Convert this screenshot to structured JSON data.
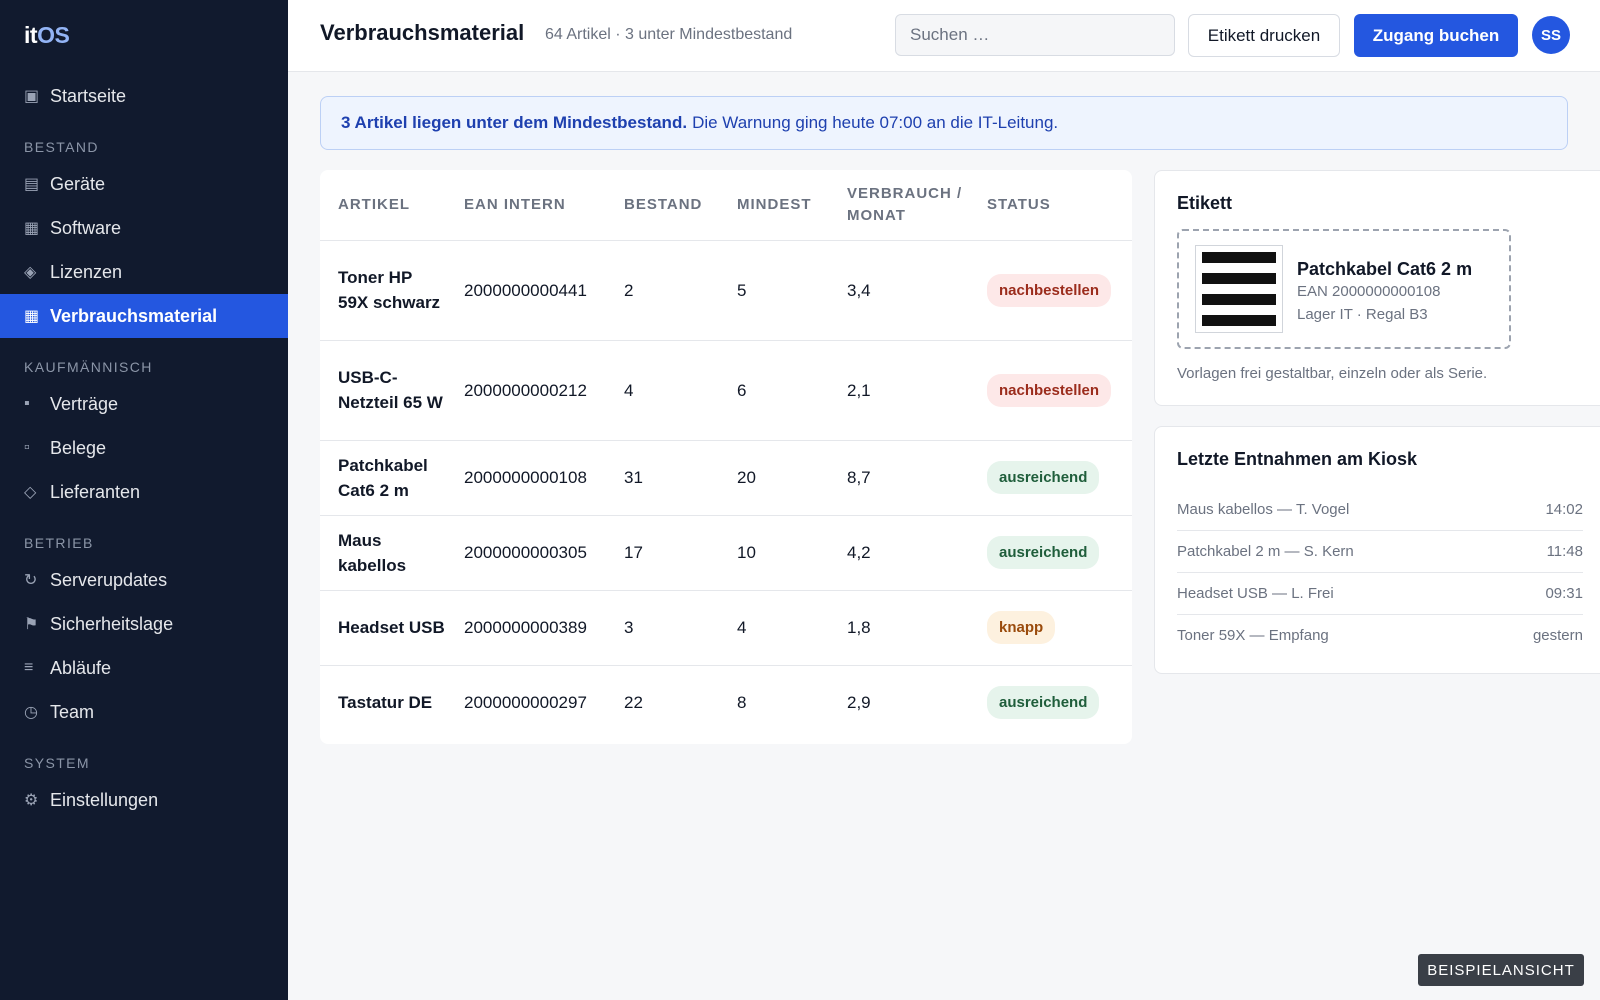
{
  "app": {
    "logo_it": "it",
    "logo_os": "OS"
  },
  "sidebar": {
    "home": {
      "label": "Startseite",
      "icon": "▣"
    },
    "sections": [
      {
        "title": "BESTAND",
        "items": [
          {
            "label": "Geräte",
            "icon": "▤"
          },
          {
            "label": "Software",
            "icon": "▦"
          },
          {
            "label": "Lizenzen",
            "icon": "◈"
          },
          {
            "label": "Verbrauchsmaterial",
            "icon": "▦",
            "active": true
          }
        ]
      },
      {
        "title": "KAUFMÄNNISCH",
        "items": [
          {
            "label": "Verträge",
            "icon": "▪"
          },
          {
            "label": "Belege",
            "icon": "▫"
          },
          {
            "label": "Lieferanten",
            "icon": "◇"
          }
        ]
      },
      {
        "title": "BETRIEB",
        "items": [
          {
            "label": "Serverupdates",
            "icon": "↻"
          },
          {
            "label": "Sicherheitslage",
            "icon": "⚑"
          },
          {
            "label": "Abläufe",
            "icon": "≡"
          },
          {
            "label": "Team",
            "icon": "◷"
          }
        ]
      },
      {
        "title": "SYSTEM",
        "items": [
          {
            "label": "Einstellungen",
            "icon": "⚙"
          }
        ]
      }
    ]
  },
  "header": {
    "title": "Verbrauchsmaterial",
    "subtitle": "64 Artikel · 3 unter Mindestbestand",
    "search_placeholder": "Suchen …",
    "print_label": "Etikett drucken",
    "book_label": "Zugang buchen",
    "avatar": "SS"
  },
  "alert": {
    "bold": "3 Artikel liegen unter dem Mindestbestand.",
    "text": "Die Warnung ging heute 07:00 an die IT-Leitung."
  },
  "table": {
    "columns": [
      "ARTIKEL",
      "EAN INTERN",
      "BESTAND",
      "MINDEST",
      "VERBRAUCH / MONAT",
      "STATUS"
    ],
    "rows": [
      {
        "name": "Toner HP 59X schwarz",
        "ean": "2000000000441",
        "stock": "2",
        "min": "5",
        "usage": "3,4",
        "status": "nachbestellen",
        "tone": "red"
      },
      {
        "name": "USB-C-Netzteil 65 W",
        "ean": "2000000000212",
        "stock": "4",
        "min": "6",
        "usage": "2,1",
        "status": "nachbestellen",
        "tone": "red"
      },
      {
        "name": "Patchkabel Cat6 2 m",
        "ean": "2000000000108",
        "stock": "31",
        "min": "20",
        "usage": "8,7",
        "status": "ausreichend",
        "tone": "green"
      },
      {
        "name": "Maus kabellos",
        "ean": "2000000000305",
        "stock": "17",
        "min": "10",
        "usage": "4,2",
        "status": "ausreichend",
        "tone": "green"
      },
      {
        "name": "Headset USB",
        "ean": "2000000000389",
        "stock": "3",
        "min": "4",
        "usage": "1,8",
        "status": "knapp",
        "tone": "amber"
      },
      {
        "name": "Tastatur DE",
        "ean": "2000000000297",
        "stock": "22",
        "min": "8",
        "usage": "2,9",
        "status": "ausreichend",
        "tone": "green"
      }
    ]
  },
  "label_card": {
    "title": "Etikett",
    "name": "Patchkabel Cat6 2 m",
    "ean": "EAN 2000000000108",
    "location": "Lager IT · Regal B3",
    "note": "Vorlagen frei gestaltbar, einzeln oder als Serie."
  },
  "kiosk": {
    "title": "Letzte Entnahmen am Kiosk",
    "entries": [
      {
        "text": "Maus kabellos — T. Vogel",
        "time": "14:02"
      },
      {
        "text": "Patchkabel 2 m — S. Kern",
        "time": "11:48"
      },
      {
        "text": "Headset USB — L. Frei",
        "time": "09:31"
      },
      {
        "text": "Toner 59X — Empfang",
        "time": "gestern"
      }
    ]
  },
  "footer_badge": "BEISPIELANSICHT",
  "colors": {
    "accent": "#2457e0",
    "sidebar": "#111a2e"
  }
}
